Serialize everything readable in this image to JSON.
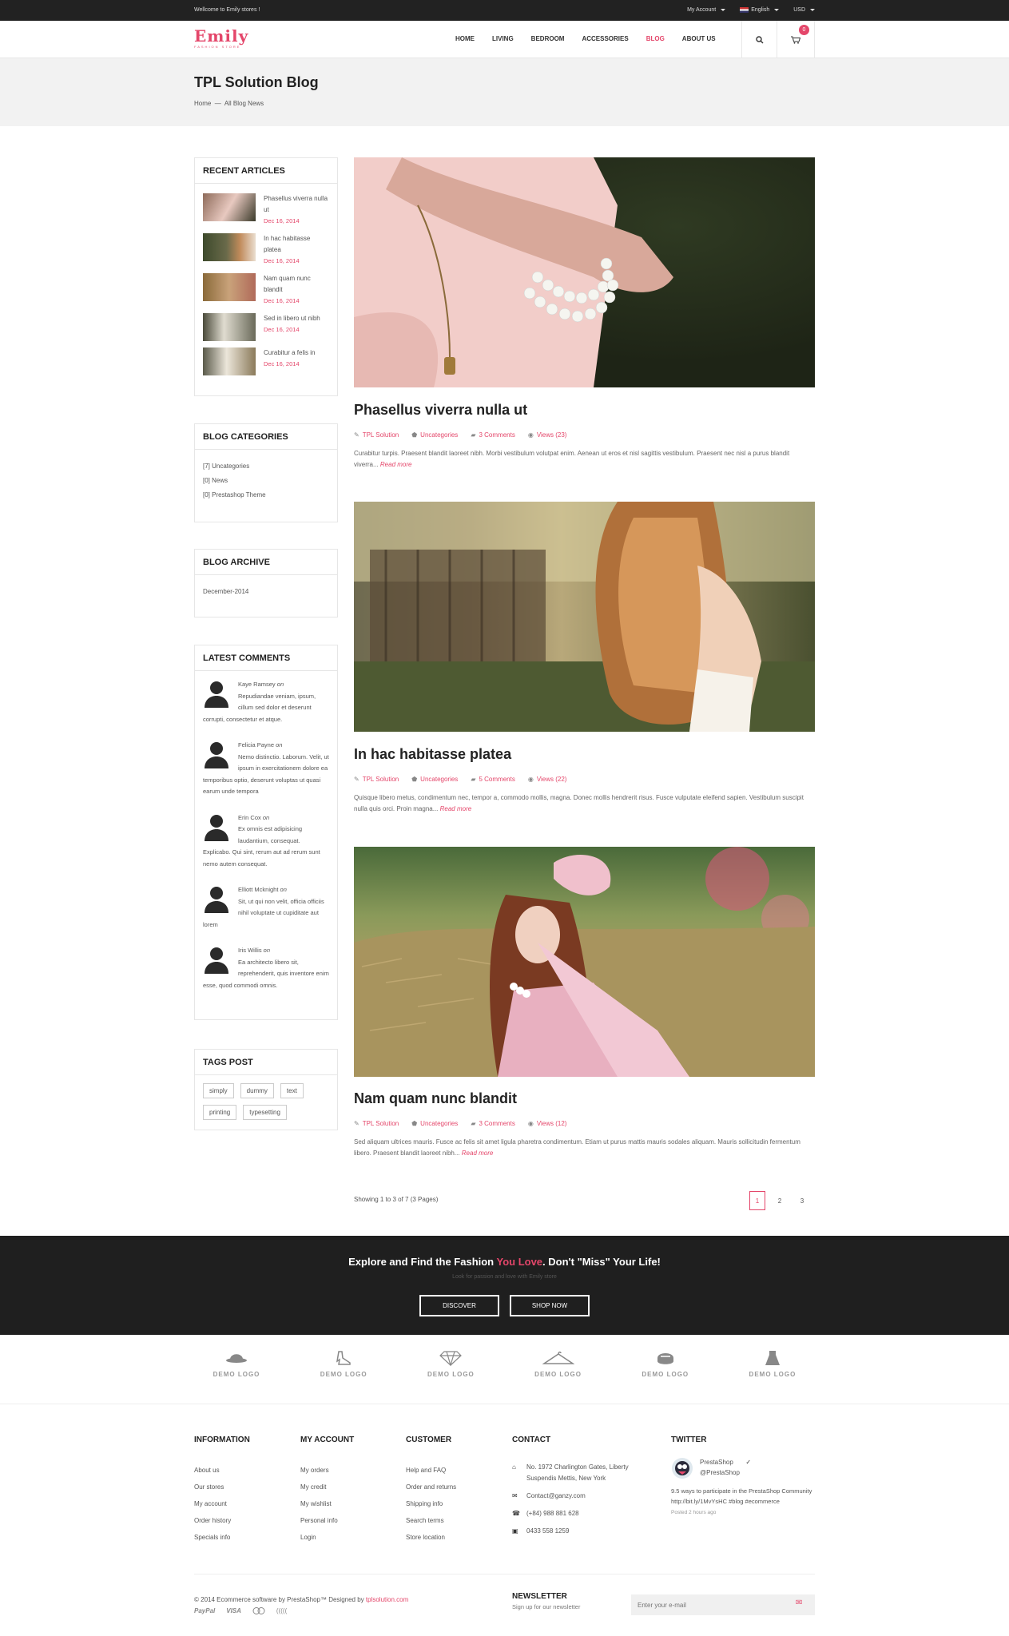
{
  "topbar": {
    "welcome": "Wellcome to Emily stores !",
    "account": "My Account",
    "language": "English",
    "currency": "USD"
  },
  "header": {
    "logo_text": "Emily",
    "logo_tagline": "FASHION STORE",
    "nav": [
      "HOME",
      "LIVING",
      "BEDROOM",
      "ACCESSORIES",
      "BLOG",
      "ABOUT US"
    ],
    "active_nav": "BLOG",
    "cart_count": "0"
  },
  "page": {
    "title": "TPL Solution Blog",
    "breadcrumb_home": "Home",
    "breadcrumb_sep": "—",
    "breadcrumb_current": "All Blog News"
  },
  "sidebar": {
    "recent_title": "RECENT ARTICLES",
    "recent": [
      {
        "title": "Phasellus viverra nulla ut",
        "date": "Dec 16, 2014"
      },
      {
        "title": "In hac habitasse platea",
        "date": "Dec 16, 2014"
      },
      {
        "title": "Nam quam nunc blandit",
        "date": "Dec 16, 2014"
      },
      {
        "title": "Sed in libero ut nibh",
        "date": "Dec 16, 2014"
      },
      {
        "title": "Curabitur a felis in",
        "date": "Dec 16, 2014"
      }
    ],
    "categories_title": "BLOG CATEGORIES",
    "categories": [
      "[7] Uncategories",
      "[0] News",
      "[0] Prestashop Theme"
    ],
    "archive_title": "BLOG ARCHIVE",
    "archive": [
      "December-2014"
    ],
    "comments_title": "LATEST COMMENTS",
    "comments": [
      {
        "author": "Kaye Ramsey",
        "on": "on",
        "text": "Repudiandae veniam, ipsum, cillum sed dolor et deserunt corrupti, consectetur et atque."
      },
      {
        "author": "Felicia Payne",
        "on": "on",
        "text": "Nemo distinctio. Laborum. Velit, ut ipsum in exercitationem dolore ea temporibus optio, deserunt voluptas ut quasi earum unde tempora"
      },
      {
        "author": "Erin Cox",
        "on": "on",
        "text": "Ex omnis est adipisicing laudantium, consequat. Explicabo. Qui sint, rerum aut ad rerum sunt nemo autem consequat."
      },
      {
        "author": "Elliott Mcknight",
        "on": "on",
        "text": "Sit, ut qui non velit, officia officiis nihil voluptate ut cupiditate aut lorem"
      },
      {
        "author": "Iris Willis",
        "on": "on",
        "text": "Ea architecto libero sit, reprehenderit, quis inventore enim esse, quod commodi omnis."
      }
    ],
    "tags_title": "TAGS POST",
    "tags": [
      "simply",
      "dummy",
      "text",
      "printing",
      "typesetting"
    ]
  },
  "posts": [
    {
      "title": "Phasellus viverra nulla ut",
      "author": "TPL Solution",
      "category": "Uncategories",
      "comments": "3 Comments",
      "views": "Views (23)",
      "excerpt": "Curabitur turpis. Praesent blandit laoreet nibh. Morbi vestibulum volutpat enim. Aenean ut eros et nisl sagittis vestibulum. Praesent nec nisl a purus blandit viverra...",
      "read_more": "Read more"
    },
    {
      "title": "In hac habitasse platea",
      "author": "TPL Solution",
      "category": "Uncategories",
      "comments": "5 Comments",
      "views": "Views (22)",
      "excerpt": "Quisque libero metus, condimentum nec, tempor a, commodo mollis, magna. Donec mollis hendrerit risus. Fusce vulputate eleifend sapien. Vestibulum suscipit nulla quis orci. Proin magna...",
      "read_more": "Read more"
    },
    {
      "title": "Nam quam nunc blandit",
      "author": "TPL Solution",
      "category": "Uncategories",
      "comments": "3 Comments",
      "views": "Views (12)",
      "excerpt": "Sed aliquam ultrices mauris. Fusce ac felis sit amet ligula pharetra condimentum. Etiam ut purus mattis mauris sodales aliquam. Mauris sollicitudin fermentum libero. Praesent blandit laoreet nibh...",
      "read_more": "Read more"
    }
  ],
  "pagination": {
    "showing": "Showing 1 to 3 of 7 (3 Pages)",
    "pages": [
      "1",
      "2",
      "3"
    ],
    "current": "1"
  },
  "promo": {
    "title_pre": "Explore and Find the Fashion ",
    "title_accent": "You Love",
    "title_post": ". Don't \"Miss\" Your Life!",
    "subtitle": "Look for passion and love with Emily store",
    "discover": "DISCOVER",
    "shop_now": "SHOP NOW"
  },
  "brands": [
    {
      "label": "DEMO LOGO",
      "icon": "hat-icon"
    },
    {
      "label": "DEMO LOGO",
      "icon": "shoe-icon"
    },
    {
      "label": "DEMO LOGO",
      "icon": "diamond-icon"
    },
    {
      "label": "DEMO LOGO",
      "icon": "hanger-icon"
    },
    {
      "label": "DEMO LOGO",
      "icon": "bag-icon"
    },
    {
      "label": "DEMO LOGO",
      "icon": "dress-icon"
    }
  ],
  "footer": {
    "information": {
      "title": "INFORMATION",
      "links": [
        "About us",
        "Our stores",
        "My account",
        "Order history",
        "Specials info"
      ]
    },
    "my_account": {
      "title": "MY ACCOUNT",
      "links": [
        "My orders",
        "My credit",
        "My wishlist",
        "Personal info",
        "Login"
      ]
    },
    "customer": {
      "title": "CUSTOMER",
      "links": [
        "Help and FAQ",
        "Order and returns",
        "Shipping info",
        "Search terms",
        "Store location"
      ]
    },
    "contact": {
      "title": "CONTACT",
      "address": "No. 1972 Charlington Gates, Liberty Suspendis Mettis, New York",
      "email": "Contact@ganzy.com",
      "phone": "(+84) 988 881 628",
      "fax": "0433 558 1259"
    },
    "twitter": {
      "title": "TWITTER",
      "name": "PrestaShop",
      "handle": "@PrestaShop",
      "tweet": "9.5 ways to participate in the PrestaShop Community http://bit.ly/1MvYsHC #blog #ecommerce",
      "time": "Posted 2 hours ago"
    },
    "copyright_pre": "© 2014 Ecommerce software by PrestaShop™ Designed by ",
    "copyright_link": "tplsolution.com",
    "payments": [
      "PayPal",
      "VISA",
      "((((("
    ],
    "newsletter_title": "NEWSLETTER",
    "newsletter_sub": "Sign up for our newsletter",
    "newsletter_placeholder": "Enter your e-mail"
  },
  "colors": {
    "accent": "#e4466a",
    "dark": "#222222",
    "promo_bg": "#1f1f1f"
  }
}
